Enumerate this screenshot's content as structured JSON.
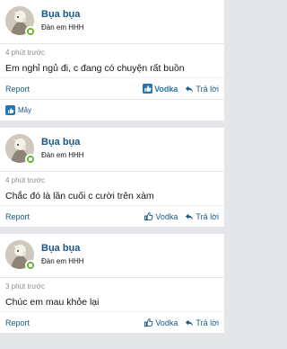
{
  "posts": [
    {
      "username": "Bụa bụa",
      "user_title": "Đàn em HHH",
      "time": "4 phút trước",
      "content": "Em nghỉ ngủ đi, c đang có chuyện rất buồn",
      "report_label": "Report",
      "reaction_label": "Vodka",
      "reaction_active": true,
      "reply_label": "Trả lời",
      "reactions_summary": "Mây"
    },
    {
      "username": "Bụa bụa",
      "user_title": "Đàn em HHH",
      "time": "4 phút trước",
      "content": "Chắc đó là lần cuối c cười trên xàm",
      "report_label": "Report",
      "reaction_label": "Vodka",
      "reaction_active": false,
      "reply_label": "Trả lời"
    },
    {
      "username": "Bụa bụa",
      "user_title": "Đàn em HHH",
      "time": "3 phút trước",
      "content": "Chúc em mau khỏe lại",
      "report_label": "Report",
      "reaction_label": "Vodka",
      "reaction_active": false,
      "reply_label": "Trả lời"
    }
  ],
  "icons": {
    "like": "thumbs-up-icon",
    "reply": "reply-icon",
    "online": "online-badge-icon"
  },
  "colors": {
    "link": "#185886",
    "accent": "#2577b1",
    "online": "#63b32e",
    "muted": "#8c8c8c",
    "background": "#e4e6e9"
  }
}
